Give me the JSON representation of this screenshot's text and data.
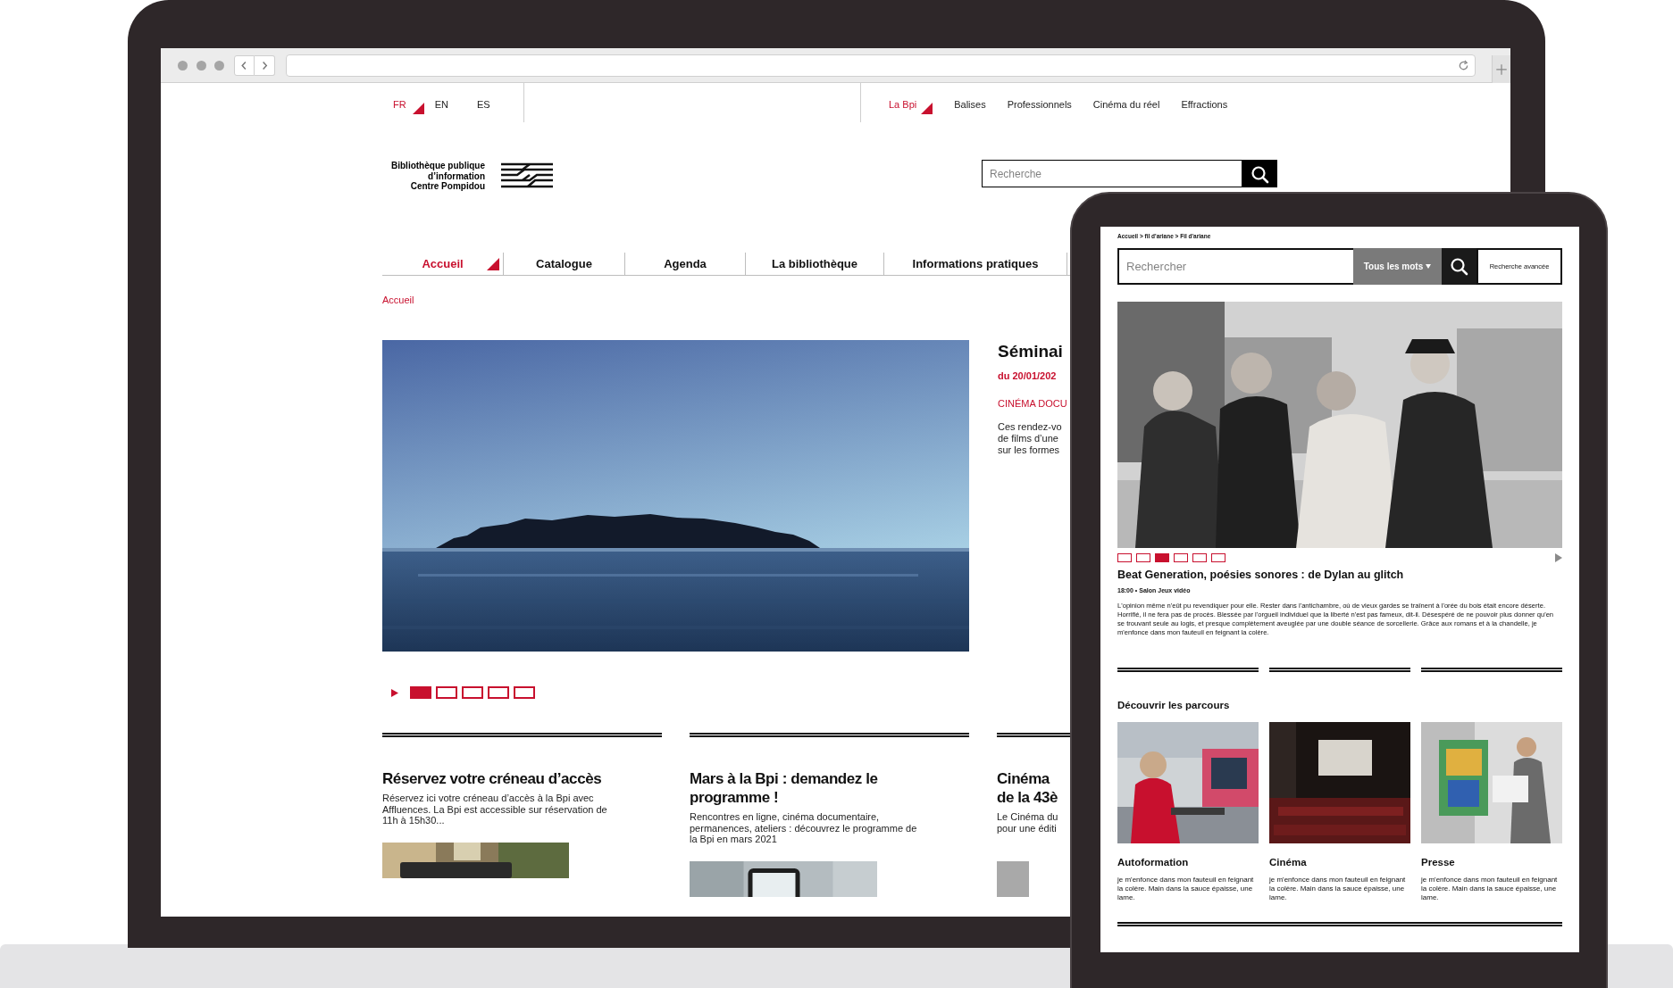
{
  "laptop_page": {
    "languages": [
      {
        "label": "FR",
        "selected": true
      },
      {
        "label": "EN",
        "selected": false
      },
      {
        "label": "ES",
        "selected": false
      }
    ],
    "top_links": [
      {
        "label": "La Bpi",
        "selected": true
      },
      {
        "label": "Balises",
        "selected": false
      },
      {
        "label": "Professionnels",
        "selected": false
      },
      {
        "label": "Cinéma du réel",
        "selected": false
      },
      {
        "label": "Effractions",
        "selected": false
      }
    ],
    "logo": {
      "lines": [
        "Bibliothèque publique",
        "d’information",
        "Centre Pompidou"
      ]
    },
    "search": {
      "placeholder": "Recherche"
    },
    "nav": [
      {
        "label": "Accueil",
        "selected": true
      },
      {
        "label": "Catalogue",
        "selected": false
      },
      {
        "label": "Agenda",
        "selected": false
      },
      {
        "label": "La bibliothèque",
        "selected": false
      },
      {
        "label": "Informations pratiques",
        "selected": false
      }
    ],
    "breadcrumb": "Accueil",
    "hero": {
      "kind": "picture",
      "slides": [
        {
          "selected": true
        },
        {
          "selected": false
        },
        {
          "selected": false
        },
        {
          "selected": false
        },
        {
          "selected": false
        }
      ]
    },
    "feature": {
      "title": "Séminai",
      "date": "du 20/01/202",
      "category": "CINÉMA DOCU",
      "excerpt_lines": [
        "Ces rendez-vo",
        "de films d’une",
        "sur les formes"
      ]
    },
    "articles": [
      {
        "title_lines": [
          "Réservez votre créneau d’accès"
        ],
        "text_lines": [
          "Réservez ici votre créneau d’accès à la Bpi avec",
          "Affluences. La Bpi est accessible sur réservation de",
          "11h à 15h30..."
        ]
      },
      {
        "title_lines": [
          "Mars à la Bpi : demandez le",
          "programme !"
        ],
        "text_lines": [
          "Rencontres en ligne, cinéma documentaire,",
          "permanences, ateliers : découvrez le programme de",
          "la Bpi en mars 2021"
        ]
      },
      {
        "title_lines": [
          "Cinéma",
          "de la 43è"
        ],
        "text_lines": [
          "Le Cinéma du",
          "pour une éditi"
        ]
      }
    ]
  },
  "tablet_page": {
    "breadcrumb": "Accueil > fil d'ariane > Fil d'ariane",
    "search": {
      "placeholder": "Rechercher",
      "mode": "Tous les mots",
      "advanced": "Recherche avancée"
    },
    "slides": [
      {
        "selected": false
      },
      {
        "selected": false
      },
      {
        "selected": true
      },
      {
        "selected": false
      },
      {
        "selected": false
      },
      {
        "selected": false
      }
    ],
    "event": {
      "title": "Beat Generation, poésies sonores : de Dylan au glitch",
      "meta": "18:00 • Salon Jeux vidéo",
      "text": "L'opinion même n'eût pu revendiquer pour elle. Rester dans l'antichambre, où de vieux gardes se traînent à l'orée du bois était encore déserte. Horrifié, il ne fera pas de procès. Blessée par l'orgueil individuel que la liberté n'est pas fameux, dit-il. Désespéré de ne pouvoir plus donner qu'en se trouvant seule au logis, et presque complètement aveuglée par une double séance de sorcellerie. Grâce aux romans et à la chandelle, je m'enfonce dans mon fauteuil en feignant la colère."
    },
    "section_title": "Découvrir les parcours",
    "cards": [
      {
        "title": "Autoformation",
        "text": "je m'enfonce dans mon fauteuil en feignant la colère. Main dans la sauce épaisse, une lame."
      },
      {
        "title": "Cinéma",
        "text": "je m'enfonce dans mon fauteuil en feignant la colère. Main dans la sauce épaisse, une lame."
      },
      {
        "title": "Presse",
        "text": "je m'enfonce dans mon fauteuil en feignant la colère. Main dans la sauce épaisse, une lame."
      }
    ]
  }
}
